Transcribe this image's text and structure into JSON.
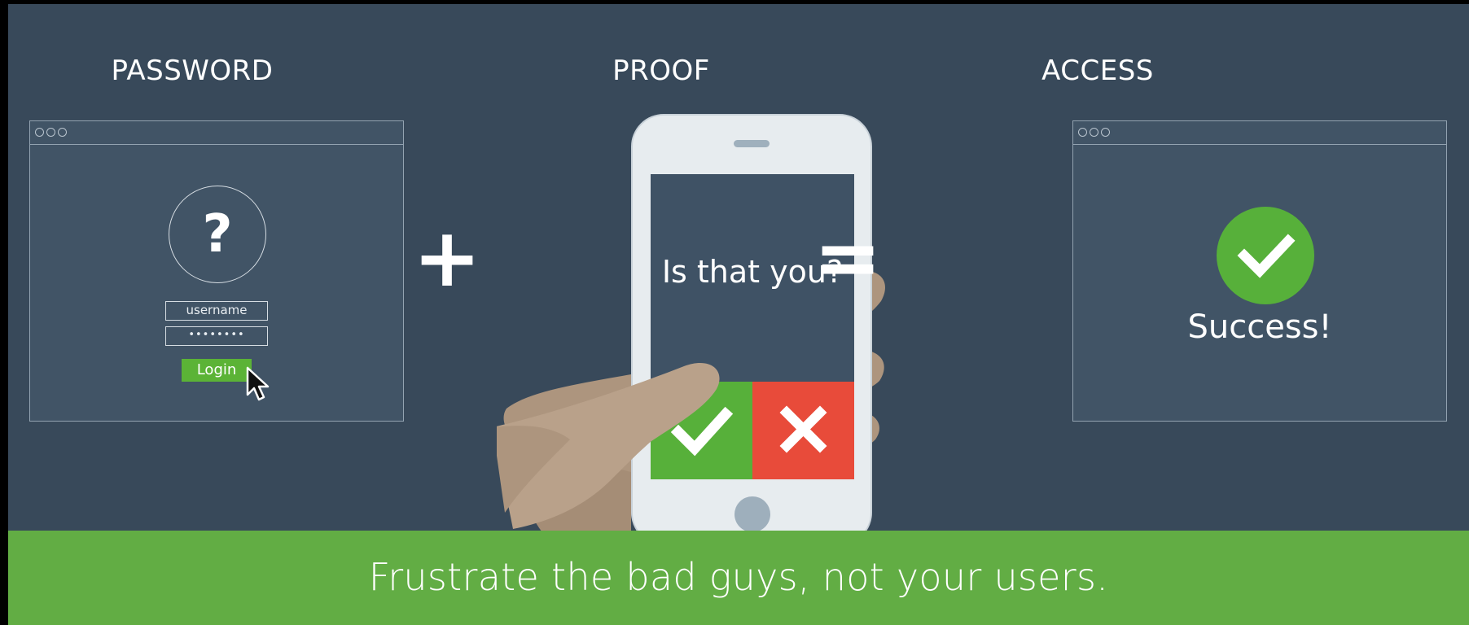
{
  "steps": {
    "password": {
      "title": "PASSWORD",
      "username_label": "username",
      "password_mask": "••••••••",
      "question_mark": "?",
      "login_label": "Login"
    },
    "proof": {
      "title": "PROOF",
      "question": "Is that you?"
    },
    "access": {
      "title": "ACCESS",
      "success_label": "Success!"
    }
  },
  "operators": {
    "plus": "+",
    "equals": "="
  },
  "footer": {
    "tagline": "Frustrate the bad guys, not your users."
  },
  "colors": {
    "background": "#38495a",
    "approve": "#57b03a",
    "deny": "#e84b3a",
    "footer": "#62ad44"
  },
  "icons": [
    "question-icon",
    "cursor-icon",
    "check-icon",
    "x-icon",
    "success-check-icon"
  ]
}
